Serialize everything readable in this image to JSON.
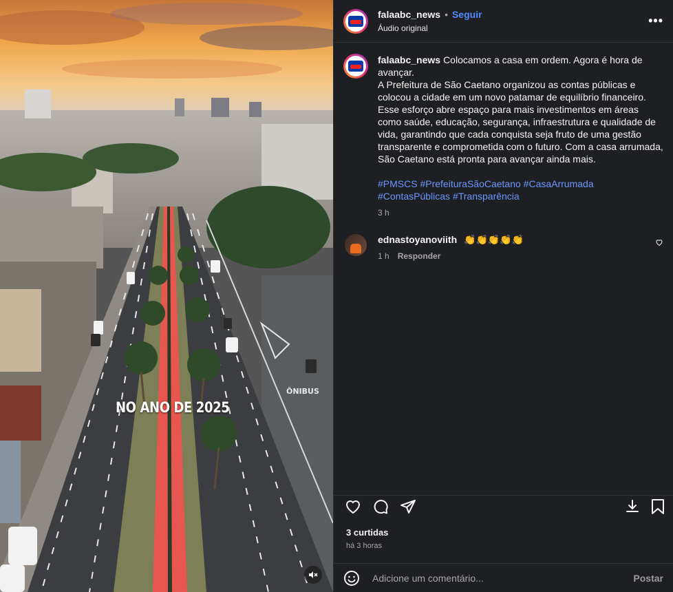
{
  "post": {
    "username": "falaabc_news",
    "follow_label": "Seguir",
    "audio_label": "Áudio original",
    "more_label": "•••"
  },
  "media": {
    "overlay_text": "NO ANO DE 2025",
    "bus_lane_text": "ÔNIBUS"
  },
  "caption": {
    "username": "falaabc_news",
    "line1": "Colocamos a casa em ordem. Agora é hora de avançar.",
    "line2": "A Prefeitura de São Caetano organizou as contas públicas e colocou a cidade em um novo patamar de equilíbrio financeiro. Esse esforço abre espaço para mais investimentos em áreas como saúde, educação, segurança, infraestrutura e qualidade de vida, garantindo que cada conquista seja fruto de uma gestão transparente e comprometida com o futuro. Com a casa arrumada, São Caetano está pronta para avançar ainda mais.",
    "hashtags": "#PMSCS #PrefeituraSãoCaetano #CasaArrumada #ContasPúblicas #Transparência",
    "time": "3 h"
  },
  "comments": [
    {
      "username": "ednastoyanoviith",
      "text": "👏👏👏👏👏",
      "time": "1 h",
      "reply_label": "Responder"
    }
  ],
  "stats": {
    "likes": "3 curtidas",
    "posted_ago": "há 3 horas"
  },
  "comment_input": {
    "placeholder": "Adicione um comentário...",
    "post_label": "Postar"
  },
  "colors": {
    "accent": "#4f8cff",
    "hashtag": "#6c96ff",
    "panel_bg": "#1e1f22",
    "bike_lane": "#e8574f"
  }
}
